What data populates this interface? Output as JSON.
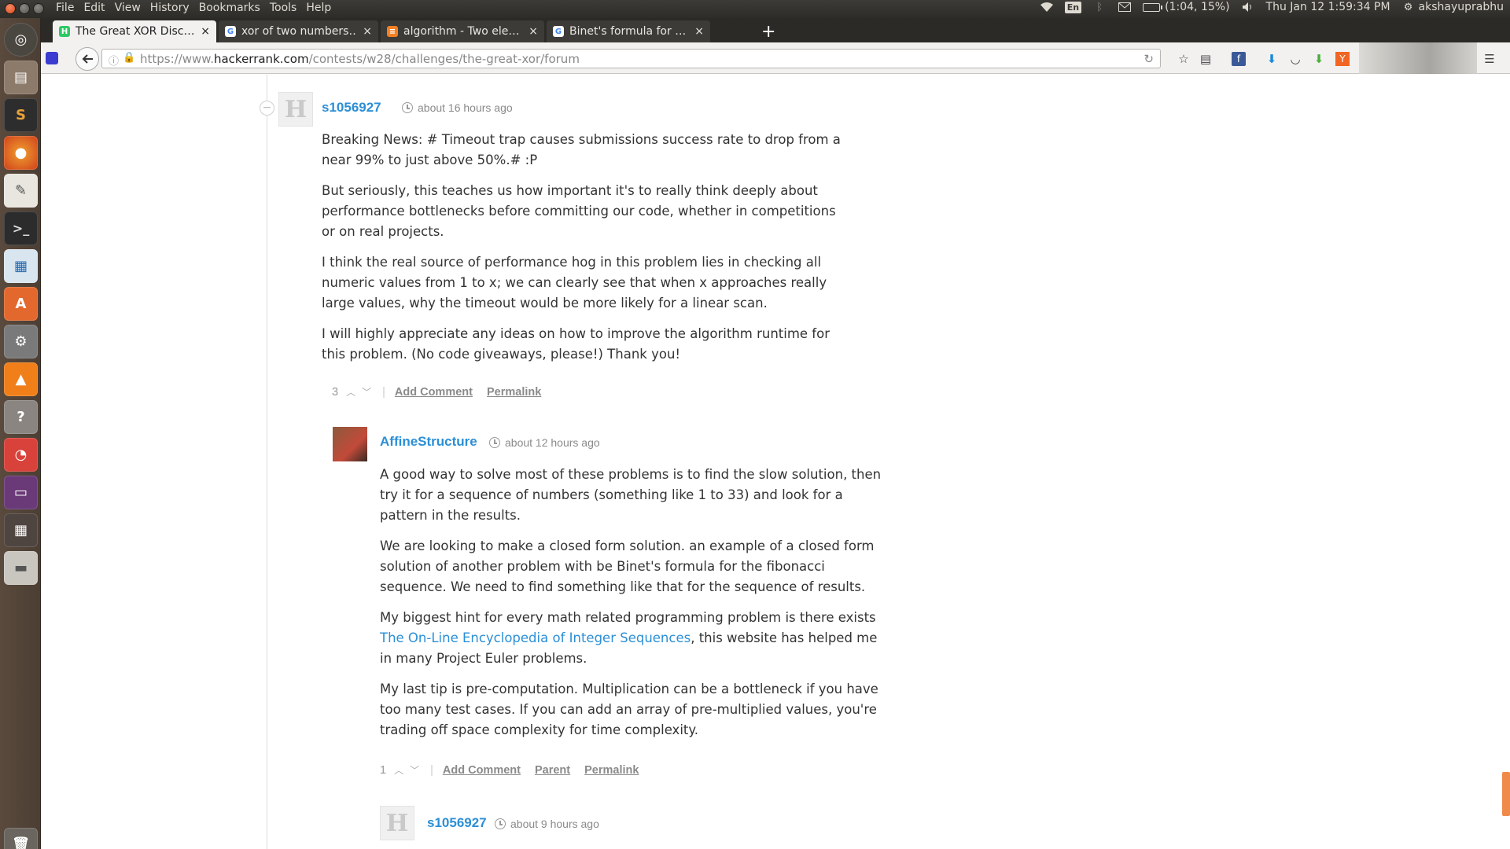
{
  "top_panel": {
    "menu": [
      "File",
      "Edit",
      "View",
      "History",
      "Bookmarks",
      "Tools",
      "Help"
    ],
    "lang": "En",
    "battery": "(1:04, 15%)",
    "datetime": "Thu Jan 12  1:59:34 PM",
    "user": "akshayuprabhu"
  },
  "tabs": [
    {
      "title": "The Great XOR Disc…",
      "favicon": "hackerrank-icon",
      "active": true
    },
    {
      "title": "xor of two numbers…",
      "favicon": "google-icon",
      "active": false
    },
    {
      "title": "algorithm - Two ele…",
      "favicon": "stackoverflow-icon",
      "active": false
    },
    {
      "title": "Binet's formula for …",
      "favicon": "google-icon",
      "active": false
    }
  ],
  "tab_close_glyph": "×",
  "new_tab_glyph": "+",
  "url": {
    "prefix": "https://www.",
    "domain": "hackerrank.com",
    "path": "/contests/w28/challenges/the-great-xor/forum"
  },
  "comments": {
    "c1": {
      "username": "s1056927",
      "time": "about 16 hours ago",
      "paragraphs": [
        "Breaking News: # Timeout trap causes submissions success rate to drop from a near 99% to just above 50%.# :P",
        "But seriously, this teaches us how important it's to really think deeply about performance bottlenecks before committing our code, whether in competitions or on real projects.",
        "I think the real source of performance hog in this problem lies in checking all numeric values from 1 to x; we can clearly see that when x approaches really large values, why the timeout would be more likely for a linear scan.",
        "I will highly appreciate any ideas on how to improve the algorithm runtime for this problem. (No code giveaways, please!) Thank you!"
      ],
      "votes": "3",
      "add_comment": "Add Comment",
      "permalink": "Permalink"
    },
    "c2": {
      "username": "AffineStructure",
      "time": "about 12 hours ago",
      "p1": "A good way to solve most of these problems is to find the slow solution, then try it for a sequence of numbers (something like 1 to 33) and look for a pattern in the results.",
      "p2": "We are looking to make a closed form solution. an example of a closed form solution of another problem with be Binet's formula for the fibonacci sequence. We need to find something like that for the sequence of results.",
      "p3_before": "My biggest hint for every math related programming problem is there exists ",
      "p3_link": "The On-Line Encyclopedia of Integer Sequences",
      "p3_after": ", this website has helped me in many Project Euler problems.",
      "p4": "My last tip is pre-computation. Multiplication can be a bottleneck if you have too many test cases. If you can add an array of pre-multiplied values, you're trading off space complexity for time complexity.",
      "votes": "1",
      "add_comment": "Add Comment",
      "parent": "Parent",
      "permalink": "Permalink"
    },
    "c3": {
      "username": "s1056927",
      "time": "about 9 hours ago"
    }
  },
  "glyphs": {
    "avatar_letter": "H",
    "up": "︿",
    "down": "﹀",
    "sep": "|",
    "collapse": "−"
  }
}
